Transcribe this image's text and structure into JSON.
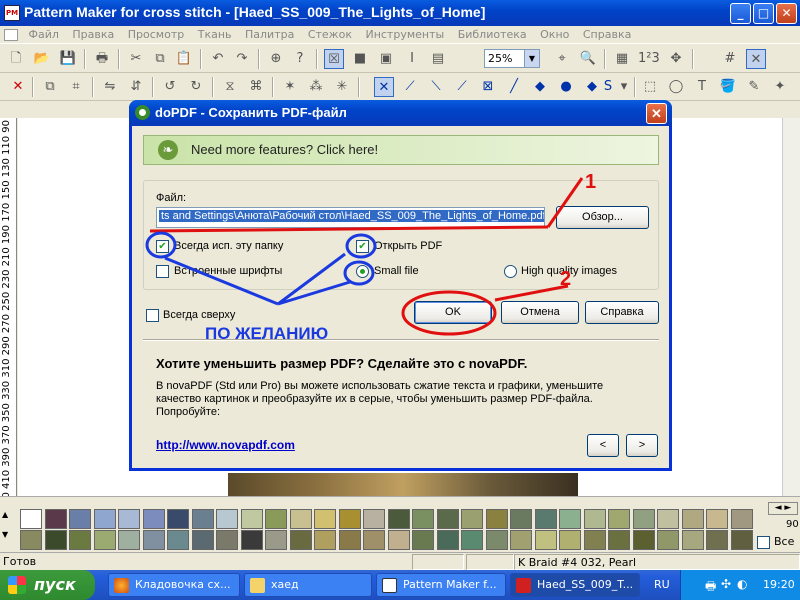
{
  "window": {
    "title": "Pattern Maker for cross stitch - [Haed_SS_009_The_Lights_of_Home]",
    "min": "_",
    "max": "□",
    "close": "✕"
  },
  "menu": [
    "Файл",
    "Правка",
    "Просмотр",
    "Ткань",
    "Палитра",
    "Стежок",
    "Инструменты",
    "Библиотека",
    "Окно",
    "Справка"
  ],
  "toolbar": {
    "zoom": "25%"
  },
  "ruler": {
    "labels": "50 430 410 390 370 350 330 310 290 270 250 230 210 190 170 150 130 110 90"
  },
  "palette": {
    "counter": "90",
    "all_label": "Все"
  },
  "status": {
    "ready": "Готов",
    "thread": "K Braid #4  032, Pearl"
  },
  "taskbar": {
    "start": "пуск",
    "tasks": [
      "Кладовочка сх...",
      "хаед",
      "Pattern Maker f...",
      "Haed_SS_009_T..."
    ],
    "lang": "RU",
    "clock": "19:20"
  },
  "dialog": {
    "title": "doPDF - Сохранить PDF-файл",
    "banner": "Need more features? Click here!",
    "file_label": "Файл:",
    "file_value": "ts and Settings\\Анюта\\Рабочий стол\\Haed_SS_009_The_Lights_of_Home.pdf",
    "browse": "Обзор...",
    "always_folder": "Всегда исп. эту папку",
    "embed_fonts": "Встроенные шрифты",
    "open_pdf": "Открыть PDF",
    "small_file": "Small file",
    "high_quality": "High quality images",
    "always_top": "Всегда сверху",
    "ok": "OK",
    "cancel": "Отмена",
    "help": "Справка",
    "promo_heading": "Хотите уменьшить размер PDF? Сделайте это с novaPDF.",
    "promo_text": "В novaPDF (Std или Pro) вы можете использовать сжатие текста и графики, уменьшите качество картинок и преобразуйте их в серые, чтобы уменьшить размер PDF-файла. Попробуйте:",
    "link": "http://www.novapdf.com",
    "prev": "<",
    "next": ">"
  },
  "annotations": {
    "one": "1",
    "two": "2",
    "optional": "ПО ЖЕЛАНИЮ"
  },
  "colors": {
    "accent": "#0831d9",
    "annotation_red": "#e01010",
    "annotation_blue": "#1a3ae0"
  }
}
